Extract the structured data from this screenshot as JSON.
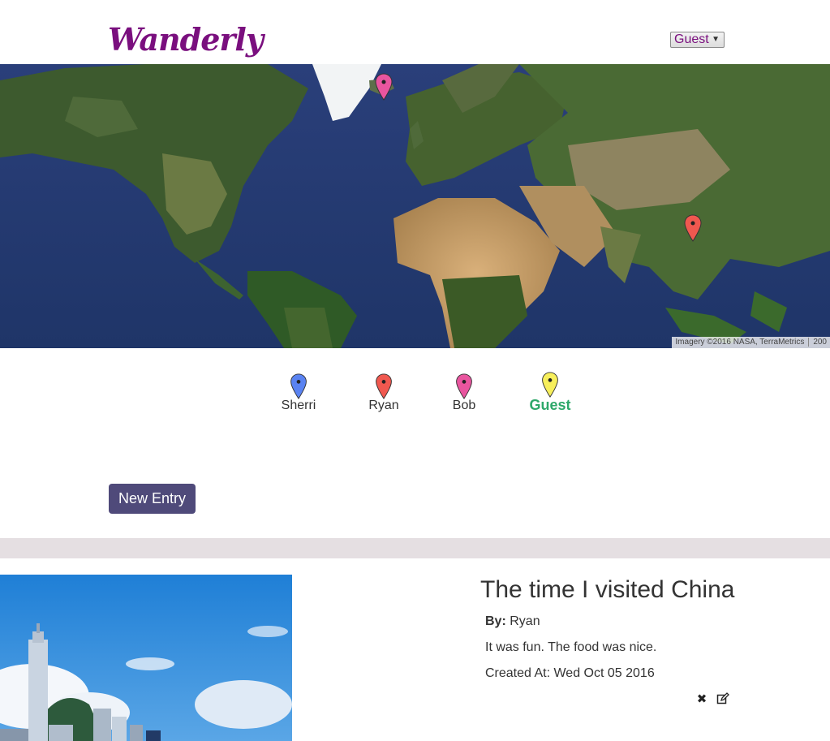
{
  "app": {
    "logo": "Wanderly",
    "user_select": {
      "selected": "Guest"
    }
  },
  "map": {
    "attribution": [
      "Imagery ©2016 NASA, TerraMetrics",
      "200"
    ],
    "markers": [
      {
        "user": "Bob",
        "color": "#e9559f"
      },
      {
        "user": "Ryan",
        "color": "#f0584f"
      }
    ]
  },
  "legend": {
    "items": [
      {
        "label": "Sherri",
        "color": "#5a83f2",
        "active": false
      },
      {
        "label": "Ryan",
        "color": "#f0584f",
        "active": false
      },
      {
        "label": "Bob",
        "color": "#e9559f",
        "active": false
      },
      {
        "label": "Guest",
        "color": "#f7ef5c",
        "active": true
      }
    ]
  },
  "toolbar": {
    "new_entry_label": "New Entry"
  },
  "entry": {
    "title": "The time I visited China",
    "by_label": "By:",
    "author": "Ryan",
    "body": "It was fun. The food was nice.",
    "created": "Created At: Wed Oct 05 2016",
    "delete_icon": "x-icon",
    "edit_icon": "edit-icon"
  }
}
